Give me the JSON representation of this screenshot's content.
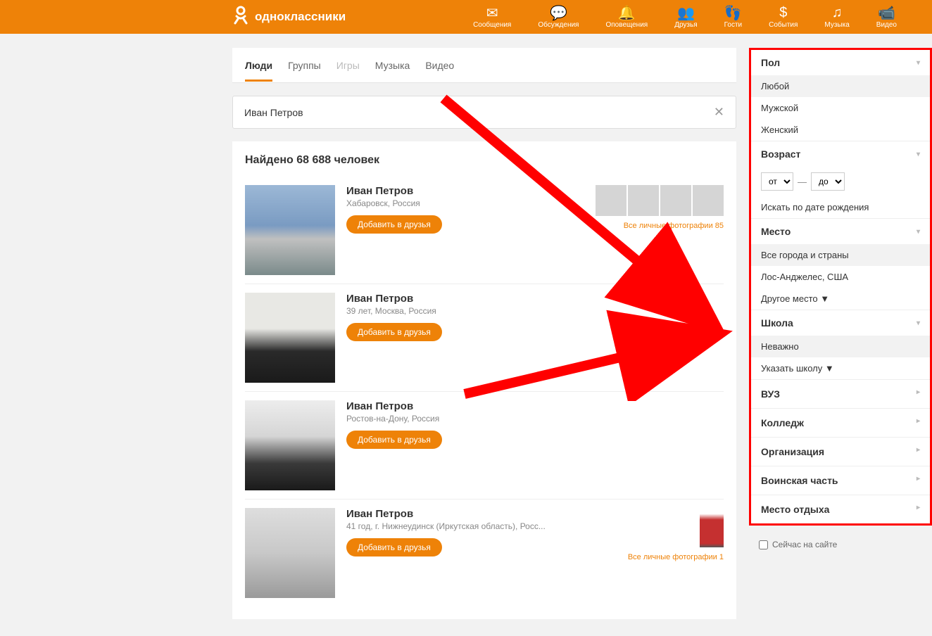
{
  "brand": "одноклассники",
  "nav": [
    {
      "label": "Сообщения",
      "icon": "✉"
    },
    {
      "label": "Обсуждения",
      "icon": "💬"
    },
    {
      "label": "Оповещения",
      "icon": "🔔"
    },
    {
      "label": "Друзья",
      "icon": "👥"
    },
    {
      "label": "Гости",
      "icon": "👣"
    },
    {
      "label": "События",
      "icon": "$"
    },
    {
      "label": "Музыка",
      "icon": "♫"
    },
    {
      "label": "Видео",
      "icon": "📹"
    }
  ],
  "tabs": [
    {
      "label": "Люди",
      "state": "active"
    },
    {
      "label": "Группы",
      "state": ""
    },
    {
      "label": "Игры",
      "state": "disabled"
    },
    {
      "label": "Музыка",
      "state": ""
    },
    {
      "label": "Видео",
      "state": ""
    }
  ],
  "search": {
    "value": "Иван Петров"
  },
  "results_header": "Найдено 68 688 человек",
  "add_label": "Добавить в друзья",
  "results": [
    {
      "name": "Иван Петров",
      "meta": "Хабаровск, Россия",
      "photos_label": "Все личные фотографии 85",
      "thumbs": 4
    },
    {
      "name": "Иван Петров",
      "meta": "39 лет, Москва, Россия",
      "photos_label": "",
      "thumbs": 0
    },
    {
      "name": "Иван Петров",
      "meta": "Ростов-на-Дону, Россия",
      "photos_label": "",
      "thumbs": 0
    },
    {
      "name": "Иван Петров",
      "meta": "41 год, г. Нижнеудинск (Иркутская область), Росс...",
      "photos_label": "Все личные фотографии 1",
      "thumbs": 1
    }
  ],
  "filters": {
    "gender": {
      "title": "Пол",
      "options": [
        "Любой",
        "Мужской",
        "Женский"
      ],
      "selected": 0
    },
    "age": {
      "title": "Возраст",
      "from": "от",
      "to": "до",
      "birthdate_link": "Искать по дате рождения"
    },
    "place": {
      "title": "Место",
      "options": [
        "Все города и страны",
        "Лос-Анджелес, США",
        "Другое место ▼"
      ],
      "selected": 0
    },
    "school": {
      "title": "Школа",
      "options": [
        "Неважно",
        "Указать школу ▼"
      ],
      "selected": 0
    },
    "collapsed": [
      "ВУЗ",
      "Колледж",
      "Организация",
      "Воинская часть",
      "Место отдыха"
    ]
  },
  "now_online": "Сейчас на сайте"
}
